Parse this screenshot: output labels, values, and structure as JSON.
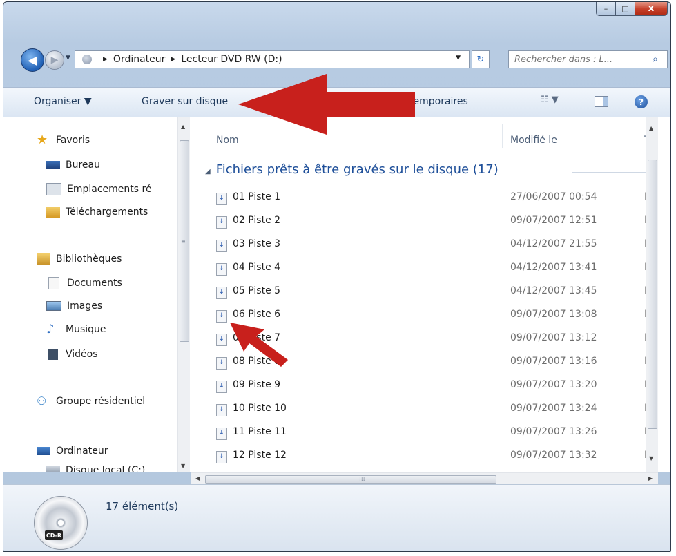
{
  "window": {
    "minimize": "–",
    "maximize": "□",
    "close": "x"
  },
  "nav": {
    "back": "◀",
    "forward": "▶",
    "recent": "▼",
    "refresh": "↻"
  },
  "address": {
    "crumbs": [
      "Ordinateur",
      "Lecteur DVD RW (D:)"
    ],
    "sep": "▶",
    "dropdown": "▼"
  },
  "search": {
    "placeholder": "Rechercher dans : L...",
    "icon": "magnifier-icon"
  },
  "toolbar": {
    "organize": "Organiser ▼",
    "burn": "Graver sur disque",
    "temp": "temporaires",
    "views": "☷ ▼",
    "help": "?"
  },
  "sidebar": {
    "favoris": "Favoris",
    "bureau": "Bureau",
    "emplacements": "Emplacements ré",
    "telechargements": "Téléchargements",
    "bibliotheques": "Bibliothèques",
    "documents": "Documents",
    "images": "Images",
    "musique": "Musique",
    "videos": "Vidéos",
    "groupe": "Groupe résidentiel",
    "ordinateur": "Ordinateur",
    "disque": "Disque local (C:)"
  },
  "columns": {
    "name": "Nom",
    "modified": "Modifié le",
    "type": "T"
  },
  "group": {
    "title": "Fichiers prêts à être gravés sur le disque (17)"
  },
  "files": [
    {
      "name": "01 Piste 1",
      "date": "27/06/2007 00:54",
      "type": "Fi"
    },
    {
      "name": "02 Piste 2",
      "date": "09/07/2007 12:51",
      "type": "Fi"
    },
    {
      "name": "03 Piste 3",
      "date": "04/12/2007 21:55",
      "type": "Fi"
    },
    {
      "name": "04 Piste 4",
      "date": "04/12/2007 13:41",
      "type": "Fi"
    },
    {
      "name": "05 Piste 5",
      "date": "04/12/2007 13:45",
      "type": "Fi"
    },
    {
      "name": "06 Piste 6",
      "date": "09/07/2007 13:08",
      "type": "Fi"
    },
    {
      "name": "07 Piste 7",
      "date": "09/07/2007 13:12",
      "type": "Fi"
    },
    {
      "name": "08 Piste 8",
      "date": "09/07/2007 13:16",
      "type": "Fi"
    },
    {
      "name": "09 Piste 9",
      "date": "09/07/2007 13:20",
      "type": "Fi"
    },
    {
      "name": "10 Piste 10",
      "date": "09/07/2007 13:24",
      "type": "Fi"
    },
    {
      "name": "11 Piste 11",
      "date": "09/07/2007 13:26",
      "type": "Fi"
    },
    {
      "name": "12 Piste 12",
      "date": "09/07/2007 13:32",
      "type": "Fi"
    }
  ],
  "status": {
    "count": "17 élément(s)",
    "drive_label": "CD-R"
  },
  "colors": {
    "arrow": "#c8201c",
    "group_title": "#1e4f99"
  }
}
